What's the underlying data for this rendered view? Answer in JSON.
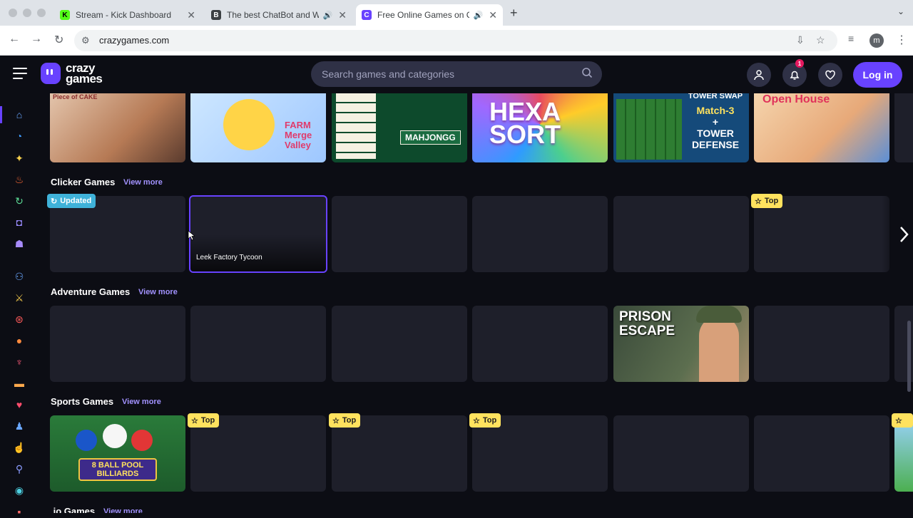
{
  "browser": {
    "tabs": [
      {
        "title": "Stream - Kick Dashboard",
        "favicon": "K",
        "favicon_color": "#53fc18"
      },
      {
        "title": "The best ChatBot and Wi",
        "favicon": "B",
        "favicon_color": "#3c4043"
      },
      {
        "title": "Free Online Games on Cra",
        "favicon": "C",
        "favicon_color": "#6842ff"
      }
    ],
    "url": "crazygames.com",
    "profile_initial": "m"
  },
  "header": {
    "logo_line1": "crazy",
    "logo_line2": "games",
    "search_placeholder": "Search games and categories",
    "notif_count": "1",
    "login_label": "Log in"
  },
  "rows": [
    {
      "title": "",
      "view_more": ""
    },
    {
      "title": "Clicker Games",
      "view_more": "View more"
    },
    {
      "title": "Adventure Games",
      "view_more": "View more"
    },
    {
      "title": "Sports Games",
      "view_more": "View more"
    },
    {
      "title": ".io Games",
      "view_more": "View more"
    }
  ],
  "top_row_titles": [
    "Piece of CAKE",
    "FARM Merge Valley",
    "MAHJONGG",
    "HEXA SORT",
    "TOWER SWAP Match-3 + TOWER DEFENSE",
    "Open House"
  ],
  "tower_swap_line1": "Match-3",
  "tower_swap_line2": "+",
  "tower_swap_line3": "TOWER",
  "tower_swap_line4": "DEFENSE",
  "clicker_card_name": "Leek Factory Tycoon",
  "badges": {
    "updated": "Updated",
    "top": "Top"
  },
  "prison_title_1": "PRISON",
  "prison_title_2": "ESCAPE",
  "pool_title_1": "8 BALL POOL",
  "pool_title_2": "BILLIARDS",
  "colors": {
    "accent": "#6842ff",
    "top_badge": "#ffe25e",
    "updated_badge": "#3fb2d9",
    "bg": "#0c0d14",
    "card_placeholder": "#1e1f2a"
  }
}
